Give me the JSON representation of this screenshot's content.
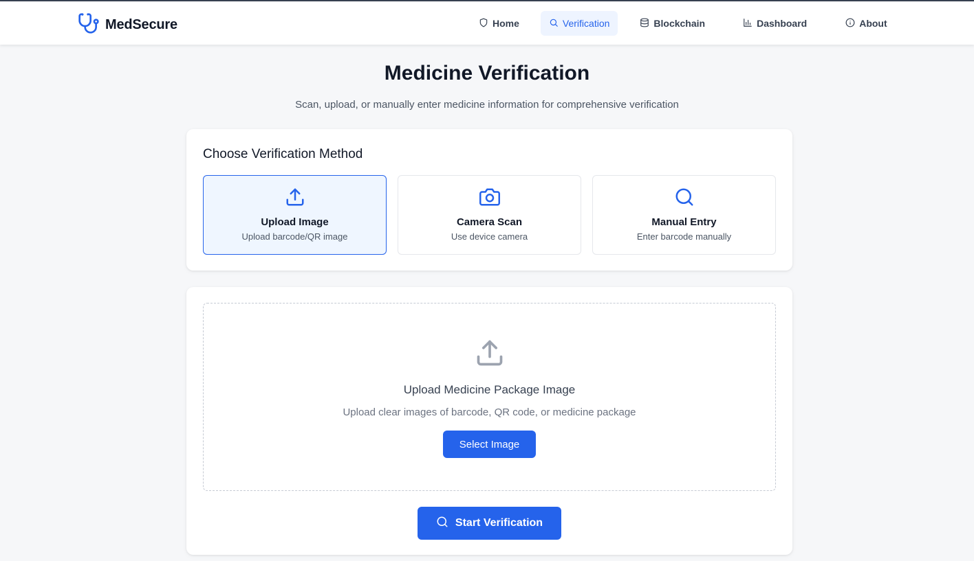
{
  "app": {
    "name": "MedSecure",
    "logo_icon": "stethoscope-icon"
  },
  "colors": {
    "accent": "#2563eb",
    "accent_light": "#eff6ff",
    "background": "#f6f7f9"
  },
  "nav": {
    "items": [
      {
        "label": "Home",
        "icon": "shield-icon",
        "active": false
      },
      {
        "label": "Verification",
        "icon": "search-icon",
        "active": true
      },
      {
        "label": "Blockchain",
        "icon": "database-icon",
        "active": false
      },
      {
        "label": "Dashboard",
        "icon": "bar-chart-icon",
        "active": false
      },
      {
        "label": "About",
        "icon": "info-icon",
        "active": false
      }
    ]
  },
  "page": {
    "title": "Medicine Verification",
    "subtitle": "Scan, upload, or manually enter medicine information for comprehensive verification"
  },
  "methods": {
    "heading": "Choose Verification Method",
    "items": [
      {
        "title": "Upload Image",
        "desc": "Upload barcode/QR image",
        "icon": "upload-icon",
        "selected": true
      },
      {
        "title": "Camera Scan",
        "desc": "Use device camera",
        "icon": "camera-icon",
        "selected": false
      },
      {
        "title": "Manual Entry",
        "desc": "Enter barcode manually",
        "icon": "search-icon",
        "selected": false
      }
    ]
  },
  "upload": {
    "title": "Upload Medicine Package Image",
    "desc": "Upload clear images of barcode, QR code, or medicine package",
    "select_label": "Select Image",
    "icon": "upload-icon"
  },
  "actions": {
    "start_label": "Start Verification"
  }
}
